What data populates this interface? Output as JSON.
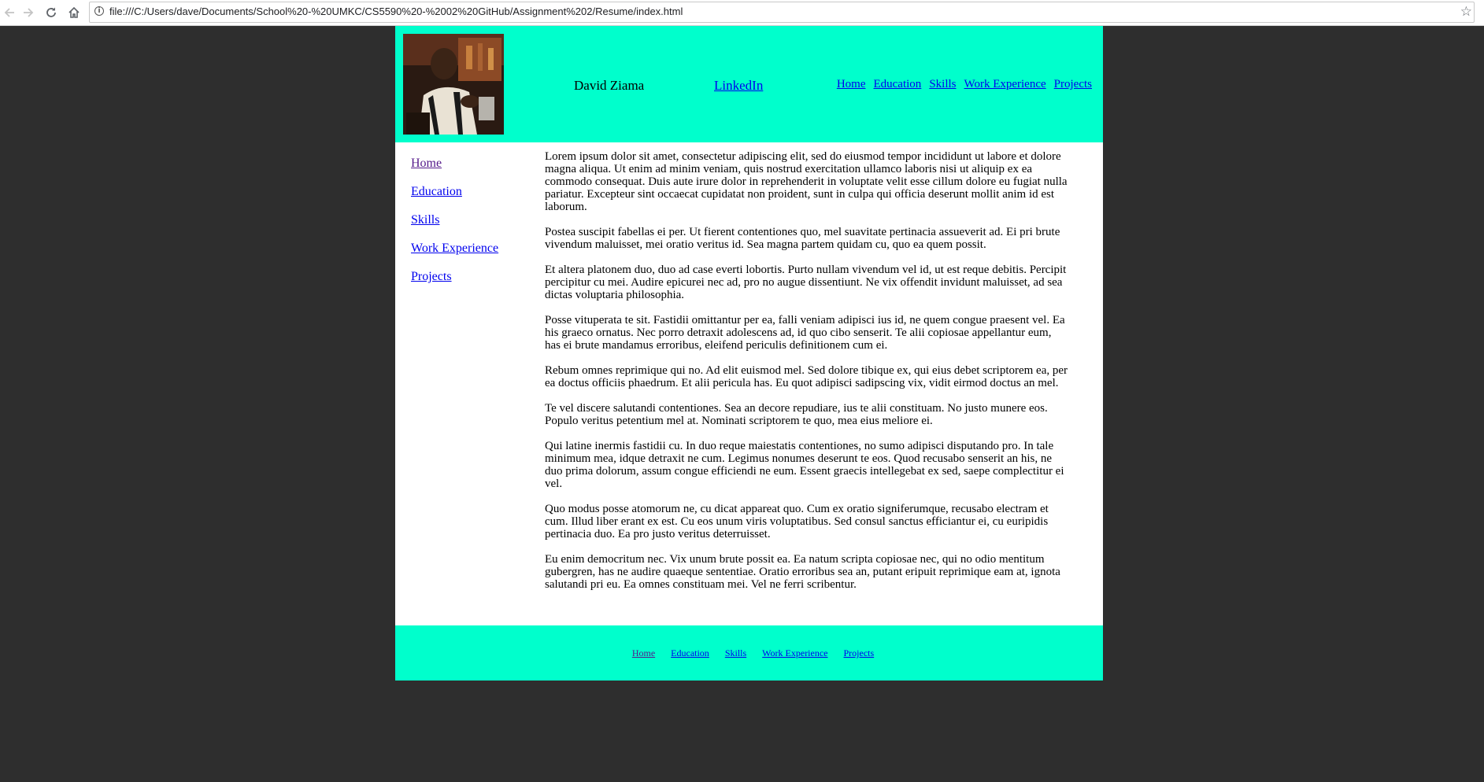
{
  "browser": {
    "url": "file:///C:/Users/dave/Documents/School%20-%20UMKC/CS5590%20-%2002%20GitHub/Assignment%202/Resume/index.html",
    "back_icon": "back-arrow-icon",
    "forward_icon": "forward-arrow-icon",
    "reload_icon": "reload-icon",
    "home_icon": "home-icon",
    "info_icon": "info-icon",
    "bookmark_icon": "star-icon"
  },
  "colors": {
    "header_bg": "#00ffcc",
    "page_bg": "#2e2e2e",
    "content_bg": "#ffffff",
    "link": "#0000ee",
    "visited_link": "#551a8b"
  },
  "header": {
    "name": "David Ziama",
    "linkedin": "LinkedIn",
    "nav": [
      "Home",
      "Education",
      "Skills",
      "Work Experience",
      "Projects"
    ]
  },
  "sidebar": {
    "items": [
      "Home",
      "Education",
      "Skills",
      "Work Experience",
      "Projects"
    ]
  },
  "main": {
    "paragraphs": [
      "Lorem ipsum dolor sit amet, consectetur adipiscing elit, sed do eiusmod tempor incididunt ut labore et dolore magna aliqua. Ut enim ad minim veniam, quis nostrud exercitation ullamco laboris nisi ut aliquip ex ea commodo consequat. Duis aute irure dolor in reprehenderit in voluptate velit esse cillum dolore eu fugiat nulla pariatur. Excepteur sint occaecat cupidatat non proident, sunt in culpa qui officia deserunt mollit anim id est laborum.",
      "Postea suscipit fabellas ei per. Ut fierent contentiones quo, mel suavitate pertinacia assueverit ad. Ei pri brute vivendum maluisset, mei oratio veritus id. Sea magna partem quidam cu, quo ea quem possit.",
      "Et altera platonem duo, duo ad case everti lobortis. Purto nullam vivendum vel id, ut est reque debitis. Percipit percipitur cu mei. Audire epicurei nec ad, pro no augue dissentiunt. Ne vix offendit invidunt maluisset, ad sea dictas voluptaria philosophia.",
      "Posse vituperata te sit. Fastidii omittantur per ea, falli veniam adipisci ius id, ne quem congue praesent vel. Ea his graeco ornatus. Nec porro detraxit adolescens ad, id quo cibo senserit. Te alii copiosae appellantur eum, has ei brute mandamus erroribus, eleifend periculis definitionem cum ei.",
      "Rebum omnes reprimique qui no. Ad elit euismod mel. Sed dolore tibique ex, qui eius debet scriptorem ea, per ea doctus officiis phaedrum. Et alii pericula has. Eu quot adipisci sadipscing vix, vidit eirmod doctus an mel.",
      "Te vel discere salutandi contentiones. Sea an decore repudiare, ius te alii constituam. No justo munere eos. Populo veritus petentium mel at. Nominati scriptorem te quo, mea eius meliore ei.",
      "Qui latine inermis fastidii cu. In duo reque maiestatis contentiones, no sumo adipisci disputando pro. In tale minimum mea, idque detraxit ne cum. Legimus nonumes deserunt te eos. Quod recusabo senserit an his, ne duo prima dolorum, assum congue efficiendi ne eum. Essent graecis intellegebat ex sed, saepe complectitur ei vel.",
      "Quo modus posse atomorum ne, cu dicat appareat quo. Cum ex oratio signiferumque, recusabo electram et cum. Illud liber erant ex est. Cu eos unum viris voluptatibus. Sed consul sanctus efficiantur ei, cu euripidis pertinacia duo. Ea pro justo veritus deterruisset.",
      "Eu enim democritum nec. Vix unum brute possit ea. Ea natum scripta copiosae nec, qui no odio mentitum gubergren, has ne audire quaeque sententiae. Oratio erroribus sea an, putant eripuit reprimique eam at, ignota salutandi pri eu. Ea omnes constituam mei. Vel ne ferri scribentur."
    ]
  },
  "footer": {
    "nav": [
      "Home",
      "Education",
      "Skills",
      "Work Experience",
      "Projects"
    ]
  }
}
